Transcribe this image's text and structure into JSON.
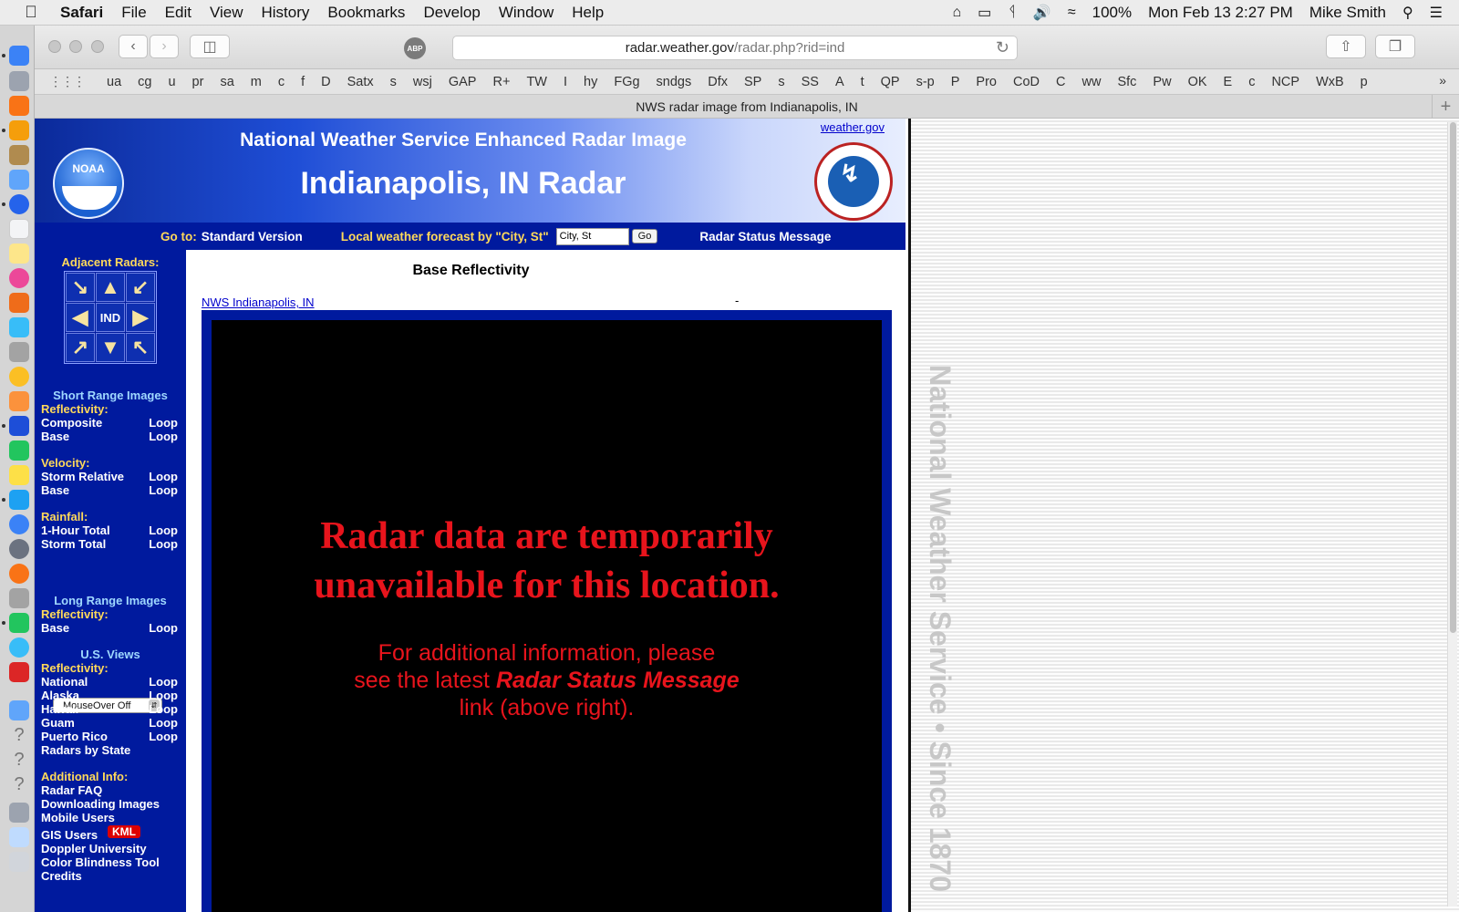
{
  "menubar": {
    "app": "Safari",
    "menus": [
      "File",
      "Edit",
      "View",
      "History",
      "Bookmarks",
      "Develop",
      "Window",
      "Help"
    ],
    "battery": "100%",
    "datetime": "Mon Feb 13  2:27 PM",
    "user": "Mike Smith"
  },
  "browser": {
    "url_domain": "radar.weather.gov",
    "url_path": "/radar.php?rid=ind",
    "tab_title": "NWS radar image from Indianapolis, IN",
    "abp_label": "ABP",
    "bookmarks": [
      "ua",
      "cg",
      "u",
      "pr",
      "sa",
      "m",
      "c",
      "f",
      "D",
      "Satx",
      "s",
      "wsj",
      "GAP",
      "R+",
      "TW",
      "I",
      "hy",
      "FGg",
      "sndgs",
      "Dfx",
      "SP",
      "s",
      "SS",
      "A",
      "t",
      "QP",
      "s-p",
      "P",
      "Pro",
      "CoD",
      "C",
      "ww",
      "Sfc",
      "Pw",
      "OK",
      "E",
      "c",
      "NCP",
      "WxB",
      "p"
    ]
  },
  "banner": {
    "noaa_label": "NOAA",
    "title": "National Weather Service Enhanced Radar Image",
    "city": "Indianapolis, IN Radar",
    "weather_link": "weather.gov"
  },
  "nav": {
    "goto_label": "Go to:",
    "standard_version": "Standard Version",
    "forecast_label": "Local weather forecast by \"City, St\"",
    "city_placeholder": "City, St",
    "go_button": "Go",
    "status_message": "Radar Status Message"
  },
  "sidebar": {
    "adjacent_title": "Adjacent Radars:",
    "adjacent_center": "IND",
    "short_range_title": "Short Range Images",
    "reflectivity_label": "Reflectivity:",
    "composite": "Composite",
    "base": "Base",
    "velocity_label": "Velocity:",
    "storm_relative": "Storm Relative",
    "rainfall_label": "Rainfall:",
    "one_hour_total": "1-Hour Total",
    "storm_total": "Storm Total",
    "loop": "Loop",
    "mouseover": "MouseOver Off",
    "long_range_title": "Long Range Images",
    "us_views_title": "U.S. Views",
    "national": "National",
    "alaska": "Alaska",
    "hawaii": "Hawaii",
    "guam": "Guam",
    "puerto_rico": "Puerto Rico",
    "radars_by_state": "Radars by State",
    "additional_info": "Additional Info:",
    "radar_faq": "Radar FAQ",
    "downloading_images": "Downloading Images",
    "mobile_users": "Mobile Users",
    "gis_users": "GIS Users",
    "kml": "KML",
    "doppler_university": "Doppler University",
    "color_blindness_tool": "Color Blindness Tool",
    "credits": "Credits"
  },
  "main": {
    "product_title": "Base Reflectivity",
    "office_link": "NWS Indianapolis, IN",
    "time_placeholder": "-",
    "message_line1": "Radar data are temporarily",
    "message_line2": "unavailable for this location.",
    "sub_line1": "For additional information, please",
    "sub_line2_prefix": "see the latest ",
    "sub_line2_bold": "Radar Status Message",
    "sub_line3": "link (above right)."
  },
  "right_pane": {
    "vertical_text": "National Weather Service • Since 1870"
  }
}
